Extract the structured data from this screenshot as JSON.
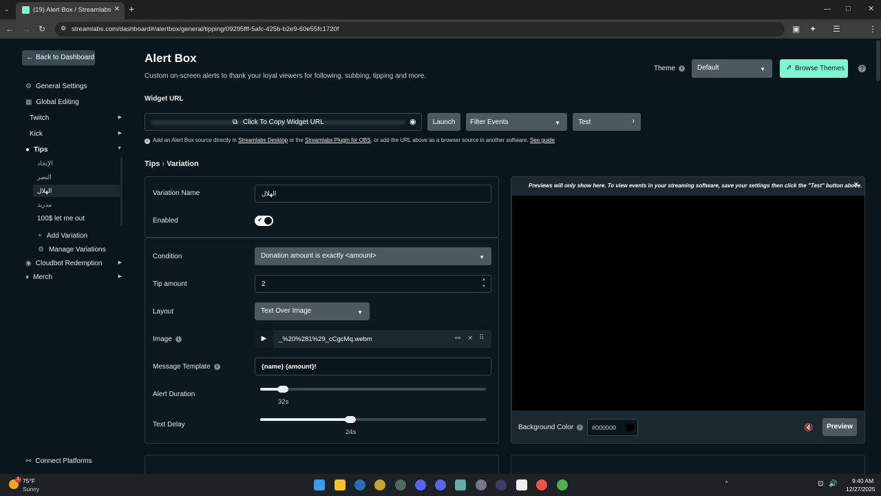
{
  "browser": {
    "tab_title": "(19) Alert Box / Streamlabs",
    "url": "streamlabs.com/dashboard#/alertbox/general/tipping/09295fff-5afc-425b-b2e9-60e55fc1720f",
    "new_tab": "+",
    "minimize": "—",
    "maximize": "□",
    "close": "✕"
  },
  "sidebar": {
    "back_label": "Back to Dashboard",
    "general_settings": "General Settings",
    "global_editing": "Global Editing",
    "twitch": "Twitch",
    "kick": "Kick",
    "tips": "Tips",
    "variations": [
      "الإتحاد",
      "النصر",
      "الهلال",
      "مدريد",
      "100$ let me out"
    ],
    "add_variation": "Add Variation",
    "manage_variations": "Manage Variations",
    "cloudbot": "Cloudbot Redemption",
    "merch": "Merch",
    "connect_platforms": "Connect Platforms"
  },
  "header": {
    "title": "Alert Box",
    "subtitle": "Custom on-screen alerts to thank your loyal viewers for following, subbing, tipping and more.",
    "theme_label": "Theme",
    "theme_value": "Default",
    "browse_themes": "Browse Themes"
  },
  "widget": {
    "url_label": "Widget URL",
    "copy_label": "Click To Copy Widget URL",
    "launch": "Launch",
    "filter_events": "Filter Events",
    "test": "Test",
    "hint_1": "Add an Alert Box source directly in ",
    "hint_link_1": "Streamlabs Desktop",
    "hint_2": " or the ",
    "hint_link_2": "Streamlabs Plugin for OBS",
    "hint_3": ", or add the URL above as a browser source in another software. ",
    "hint_link_3": "See guide"
  },
  "breadcrumb": {
    "a": "Tips",
    "sep": "›",
    "b": "Variation"
  },
  "form": {
    "variation_name_label": "Variation Name",
    "variation_name_value": "الهلال",
    "enabled_label": "Enabled",
    "enabled": true,
    "condition_label": "Condition",
    "condition_value": "Donation amount is exactly <amount>",
    "tip_amount_label": "Tip amount",
    "tip_amount_value": "2",
    "layout_label": "Layout",
    "layout_value": "Text Over Image",
    "image_label": "Image",
    "image_value": "_%20%281%29_cCgcMq.webm",
    "message_label": "Message Template",
    "message_value": "{name} {amount}!",
    "duration_label": "Alert Duration",
    "duration_value": "32s",
    "duration_fraction": 0.1,
    "delay_label": "Text Delay",
    "delay_value": "24s",
    "delay_fraction": 0.4
  },
  "preview": {
    "notice": "Previews will only show here. To view events in your streaming software, save your settings then click the \"Test\" button above.",
    "bg_label": "Background Color",
    "bg_value": "#000000",
    "preview_button": "Preview"
  },
  "taskbar": {
    "temp": "75°F",
    "weather": "Sunny",
    "time": "9:40 AM",
    "date": "12/27/2025",
    "badge": "1"
  },
  "colors": {
    "accent": "#80f5d2",
    "page_bg": "#09161d"
  }
}
